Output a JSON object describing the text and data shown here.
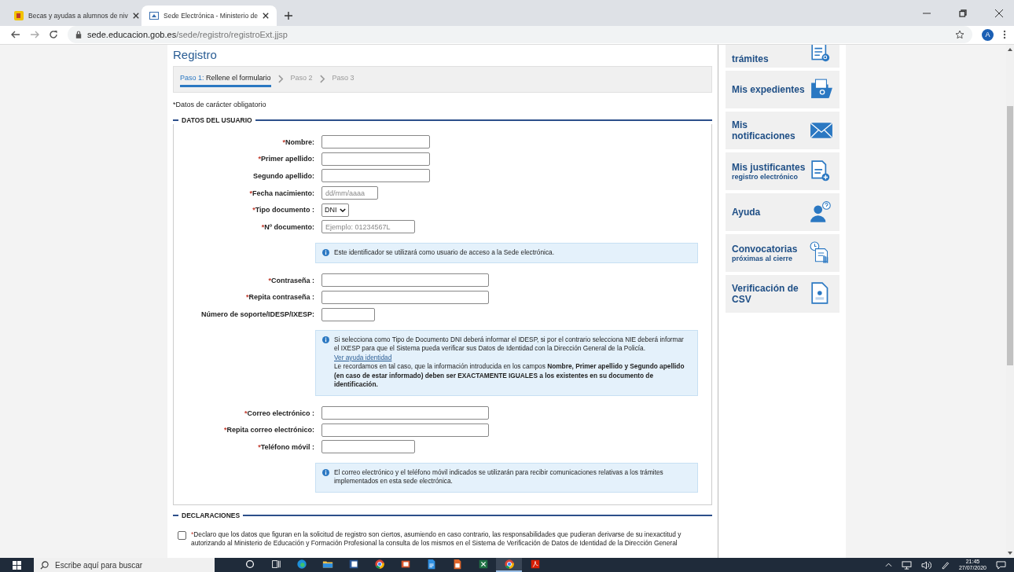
{
  "browser": {
    "tabs": [
      {
        "title": "Becas y ayudas a alumnos de niv",
        "selected": false
      },
      {
        "title": "Sede Electrónica - Ministerio de",
        "selected": true
      }
    ],
    "url_host": "sede.educacion.gob.es",
    "url_path": "/sede/registro/registroExt.jjsp",
    "profile": "A"
  },
  "page": {
    "title": "Registro",
    "steps": [
      {
        "prefix": "Paso 1:",
        "label": "Rellene el formulario",
        "selected": true
      },
      {
        "prefix": "Paso 2",
        "selected": false
      },
      {
        "prefix": "Paso 3",
        "selected": false
      }
    ],
    "required_note": "*Datos de carácter obligatorio",
    "user_section": {
      "legend": "DATOS DEL USUARIO",
      "rows": [
        {
          "kind": "field",
          "label": "Nombre:",
          "mark": "*"
        },
        {
          "kind": "field",
          "label": "Primer apellido:",
          "mark": "*"
        },
        {
          "kind": "field",
          "label": "Segundo apellido:"
        },
        {
          "kind": "field",
          "label": "Fecha nacimiento:",
          "mark": "*",
          "placeholder": "dd/mm/aaaa"
        },
        {
          "kind": "select",
          "label": "Tipo documento :",
          "mark": "*",
          "value": "DNI"
        },
        {
          "kind": "field",
          "label": "Nº documento:",
          "mark": "*",
          "placeholder": "Ejemplo: 01234567L"
        },
        {
          "kind": "info",
          "parts": [
            {
              "kind": "text",
              "text": "Este identificador se utilizará como usuario de acceso a la Sede electrónica."
            }
          ]
        },
        {
          "kind": "field",
          "label": "Contraseña :",
          "mark": "*"
        },
        {
          "kind": "field",
          "label": "Repita contraseña :",
          "mark": "*"
        },
        {
          "kind": "field",
          "label": "Número de soporte/IDESP/IXESP:"
        },
        {
          "kind": "info",
          "parts": [
            {
              "kind": "text",
              "text": "Si selecciona como Tipo de Documento DNI deberá informar el IDESP, si por el contrario selecciona NIE deberá informar el IXESP para que el Sistema pueda verificar sus Datos de Identidad con la Dirección General de la Policía."
            },
            {
              "kind": "link",
              "text": "Ver ayuda identidad"
            },
            {
              "kind": "text",
              "text": "Le recordamos en tal caso, que la información introducida en los campos **Nombre, Primer apellido y Segundo apellido (en caso de estar informado) deben ser EXACTAMENTE IGUALES a los existentes en su documento de identificación.**"
            }
          ]
        },
        {
          "kind": "field",
          "label": "Correo electrónico :",
          "mark": "*"
        },
        {
          "kind": "field",
          "label": "Repita correo electrónico:",
          "mark": "*"
        },
        {
          "kind": "field",
          "label": "Teléfono móvil :",
          "mark": "*"
        },
        {
          "kind": "info",
          "parts": [
            {
              "kind": "text",
              "text": "El correo electrónico y el teléfono móvil indicados se utilizarán para recibir comunicaciones relativas a los trámites implementados en esta sede electrónica."
            }
          ]
        }
      ]
    },
    "declarations": {
      "legend": "DECLARACIONES",
      "items": [
        {
          "checked": false,
          "mark": "*",
          "text": "Declaro que los datos que figuran en la solicitud de registro son ciertos, asumiendo en caso contrario, las responsabilidades que pudieran derivarse de su inexactitud y autorizando al Ministerio de Educación y Formación Profesional la consulta de los mismos en el Sistema de Verificación de Datos de Identidad de la Dirección General"
        }
      ]
    }
  },
  "sidebar": {
    "items": [
      {
        "title": "trámites"
      },
      {
        "title": "Mis expedientes"
      },
      {
        "title": "Mis notificaciones"
      },
      {
        "title": "Mis justificantes",
        "subtitle": "registro electrónico"
      },
      {
        "title": "Ayuda"
      },
      {
        "title": "Convocatorias",
        "subtitle": "próximas al cierre"
      },
      {
        "title": "Verificación de CSV"
      }
    ]
  },
  "taskbar": {
    "search_placeholder": "Escribe aquí para buscar",
    "apps": [
      {
        "active": false
      },
      {
        "active": false
      },
      {
        "active": false
      },
      {
        "active": false
      },
      {
        "active": false
      },
      {
        "active": false
      },
      {
        "active": false
      },
      {
        "active": false
      },
      {
        "active": false
      },
      {
        "active": false
      },
      {
        "active": true
      },
      {
        "active": false
      }
    ],
    "time": "21:45",
    "date": "27/07/2020"
  }
}
